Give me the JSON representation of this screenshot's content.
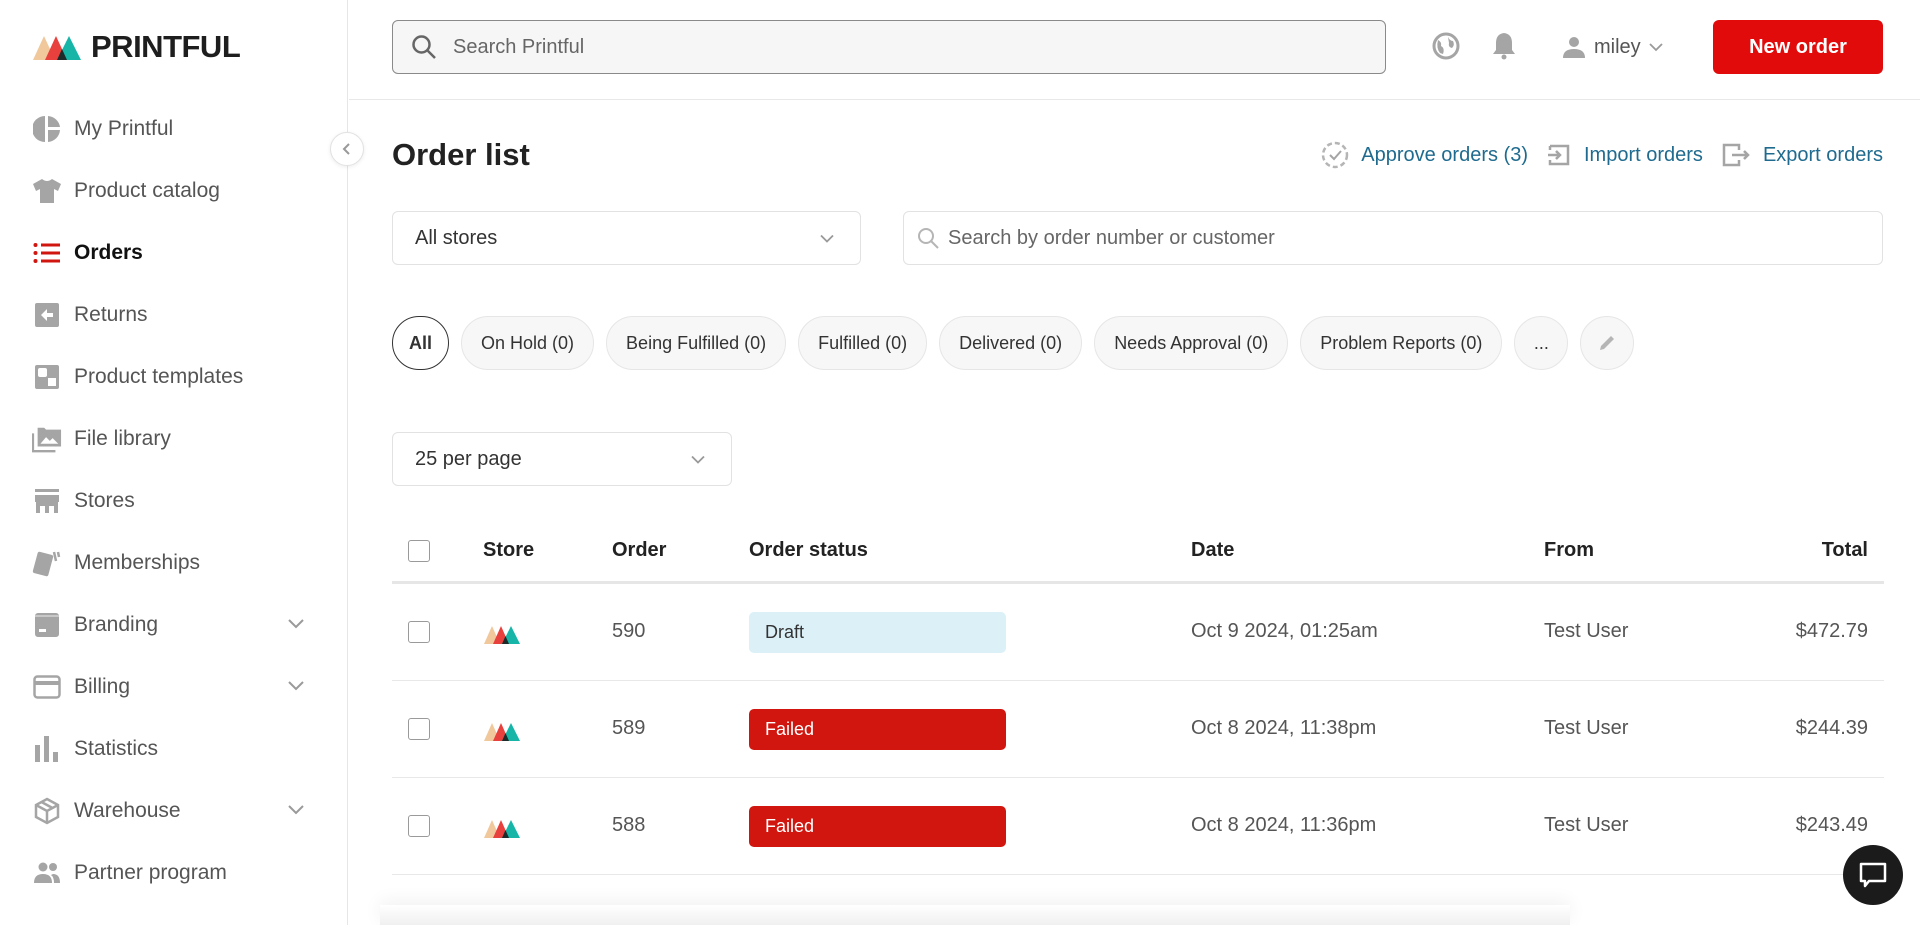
{
  "brand": {
    "name": "PRINTFUL",
    "accent": "#e10b0b",
    "link_color": "#1f6b8f"
  },
  "sidebar": {
    "items": [
      {
        "label": "My Printful",
        "icon": "dashboard-pie-icon",
        "active": false,
        "expandable": false
      },
      {
        "label": "Product catalog",
        "icon": "tshirt-icon",
        "active": false,
        "expandable": false
      },
      {
        "label": "Orders",
        "icon": "list-icon",
        "active": true,
        "expandable": false
      },
      {
        "label": "Returns",
        "icon": "return-arrow-icon",
        "active": false,
        "expandable": false
      },
      {
        "label": "Product templates",
        "icon": "templates-icon",
        "active": false,
        "expandable": false
      },
      {
        "label": "File library",
        "icon": "image-library-icon",
        "active": false,
        "expandable": false
      },
      {
        "label": "Stores",
        "icon": "storefront-icon",
        "active": false,
        "expandable": false
      },
      {
        "label": "Memberships",
        "icon": "membership-cards-icon",
        "active": false,
        "expandable": false
      },
      {
        "label": "Branding",
        "icon": "branding-box-icon",
        "active": false,
        "expandable": true
      },
      {
        "label": "Billing",
        "icon": "credit-card-icon",
        "active": false,
        "expandable": true
      },
      {
        "label": "Statistics",
        "icon": "bar-chart-icon",
        "active": false,
        "expandable": false
      },
      {
        "label": "Warehouse",
        "icon": "package-icon",
        "active": false,
        "expandable": true
      },
      {
        "label": "Partner program",
        "icon": "people-icon",
        "active": false,
        "expandable": false
      }
    ]
  },
  "topbar": {
    "search_placeholder": "Search Printful",
    "user_name": "miley",
    "new_order_label": "New order"
  },
  "main": {
    "title": "Order list",
    "actions": {
      "approve": "Approve orders (3)",
      "import": "Import orders",
      "export": "Export orders"
    },
    "store_filter": "All stores",
    "order_search_placeholder": "Search by order number or customer",
    "chips": [
      {
        "label": "All",
        "active": true
      },
      {
        "label": "On Hold (0)",
        "active": false
      },
      {
        "label": "Being Fulfilled (0)",
        "active": false
      },
      {
        "label": "Fulfilled (0)",
        "active": false
      },
      {
        "label": "Delivered (0)",
        "active": false
      },
      {
        "label": "Needs Approval (0)",
        "active": false
      },
      {
        "label": "Problem Reports (0)",
        "active": false
      },
      {
        "label": "...",
        "active": false
      }
    ],
    "per_page": "25 per page"
  },
  "table": {
    "columns": [
      "Store",
      "Order",
      "Order status",
      "Date",
      "From",
      "Total"
    ],
    "rows": [
      {
        "order": "590",
        "status": "Draft",
        "status_type": "draft",
        "date": "Oct 9 2024, 01:25am",
        "from": "Test User",
        "total": "$472.79"
      },
      {
        "order": "589",
        "status": "Failed",
        "status_type": "failed",
        "date": "Oct 8 2024, 11:38pm",
        "from": "Test User",
        "total": "$244.39"
      },
      {
        "order": "588",
        "status": "Failed",
        "status_type": "failed",
        "date": "Oct 8 2024, 11:36pm",
        "from": "Test User",
        "total": "$243.49"
      }
    ]
  }
}
